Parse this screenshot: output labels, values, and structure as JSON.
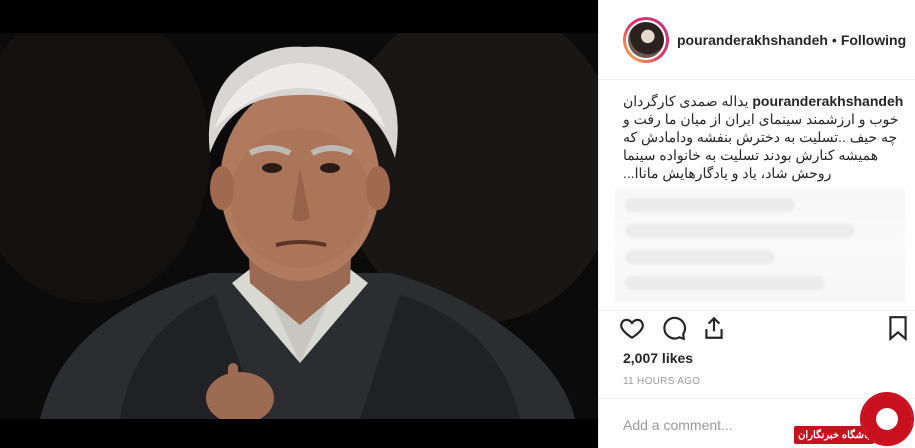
{
  "post": {
    "username": "pouranderakhshandeh",
    "follow_label": "Following",
    "separator": "•",
    "caption": "یداله صمدی کارگردان خوب و ارزشمند سینمای ایران از میان ما رفت و چه حیف ..تسلیت به دخترش بنفشه ودامادش که همیشه کنارش بودند تسلیت به خانواده سینما روحش شاد، یاد و یادگارهایش ماناا...",
    "likes": "2,007 likes",
    "time": "11 HOURS AGO",
    "comment_placeholder": "Add a comment..."
  },
  "icons": {
    "like": "heart-icon",
    "comment": "comment-icon",
    "share": "share-icon",
    "save": "bookmark-icon"
  },
  "watermark": {
    "text": "باشگاه خبرنگاران"
  },
  "colors": {
    "text": "#262626",
    "muted": "#999999",
    "border": "#efefef",
    "watermark_red": "#c8101e"
  }
}
